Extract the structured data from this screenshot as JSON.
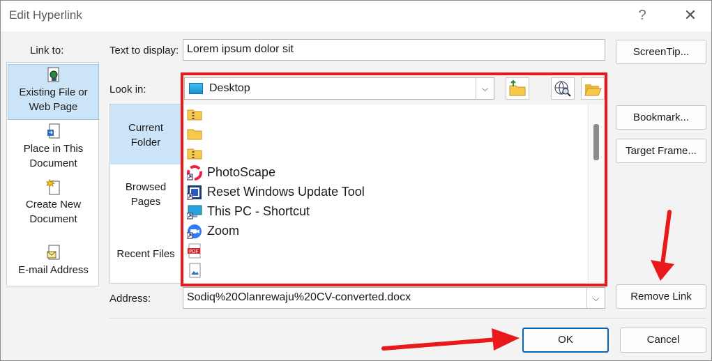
{
  "window": {
    "title": "Edit Hyperlink",
    "help_glyph": "?",
    "close_glyph": "✕"
  },
  "link_to": {
    "label": "Link to:",
    "items": [
      {
        "line1": "Existing File or",
        "line2": "Web Page",
        "icon": "existing-file-icon",
        "selected": true
      },
      {
        "line1": "Place in This",
        "line2": "Document",
        "icon": "place-in-document-icon",
        "selected": false
      },
      {
        "line1": "Create New",
        "line2": "Document",
        "icon": "new-document-icon",
        "selected": false
      },
      {
        "line1": "E-mail Address",
        "line2": "",
        "icon": "email-icon",
        "selected": false
      }
    ]
  },
  "text_to_display": {
    "label": "Text to display:",
    "value": "Lorem ipsum dolor sit"
  },
  "look_in": {
    "label": "Look in:",
    "value": "Desktop",
    "dropdown_glyph": "⌵"
  },
  "places": [
    {
      "line1": "Current",
      "line2": "Folder",
      "selected": true
    },
    {
      "line1": "Browsed",
      "line2": "Pages",
      "selected": false
    },
    {
      "line1": "Recent Files",
      "line2": "",
      "selected": false
    }
  ],
  "files": [
    {
      "name": "",
      "icon": "zip-folder-icon"
    },
    {
      "name": "",
      "icon": "folder-icon"
    },
    {
      "name": "",
      "icon": "zip-folder-icon"
    },
    {
      "name": "PhotoScape",
      "icon": "photoscape-shortcut-icon"
    },
    {
      "name": "Reset Windows Update Tool",
      "icon": "reset-tool-shortcut-icon"
    },
    {
      "name": "This PC - Shortcut",
      "icon": "this-pc-shortcut-icon"
    },
    {
      "name": "Zoom",
      "icon": "zoom-shortcut-icon"
    },
    {
      "name": "",
      "icon": "pdf-file-icon"
    },
    {
      "name": "",
      "icon": "image-file-icon"
    }
  ],
  "address": {
    "label": "Address:",
    "value": "Sodiq%20Olanrewaju%20CV-converted.docx",
    "dropdown_glyph": "⌵"
  },
  "buttons": {
    "screentip": "ScreenTip...",
    "bookmark": "Bookmark...",
    "target_frame": "Target Frame...",
    "remove_link": "Remove Link",
    "ok": "OK",
    "cancel": "Cancel"
  },
  "colors": {
    "highlight_frame": "#e8181b",
    "annotation_arrow": "#e8181b",
    "selection": "#cce4f7",
    "primary_border": "#0067c0"
  }
}
